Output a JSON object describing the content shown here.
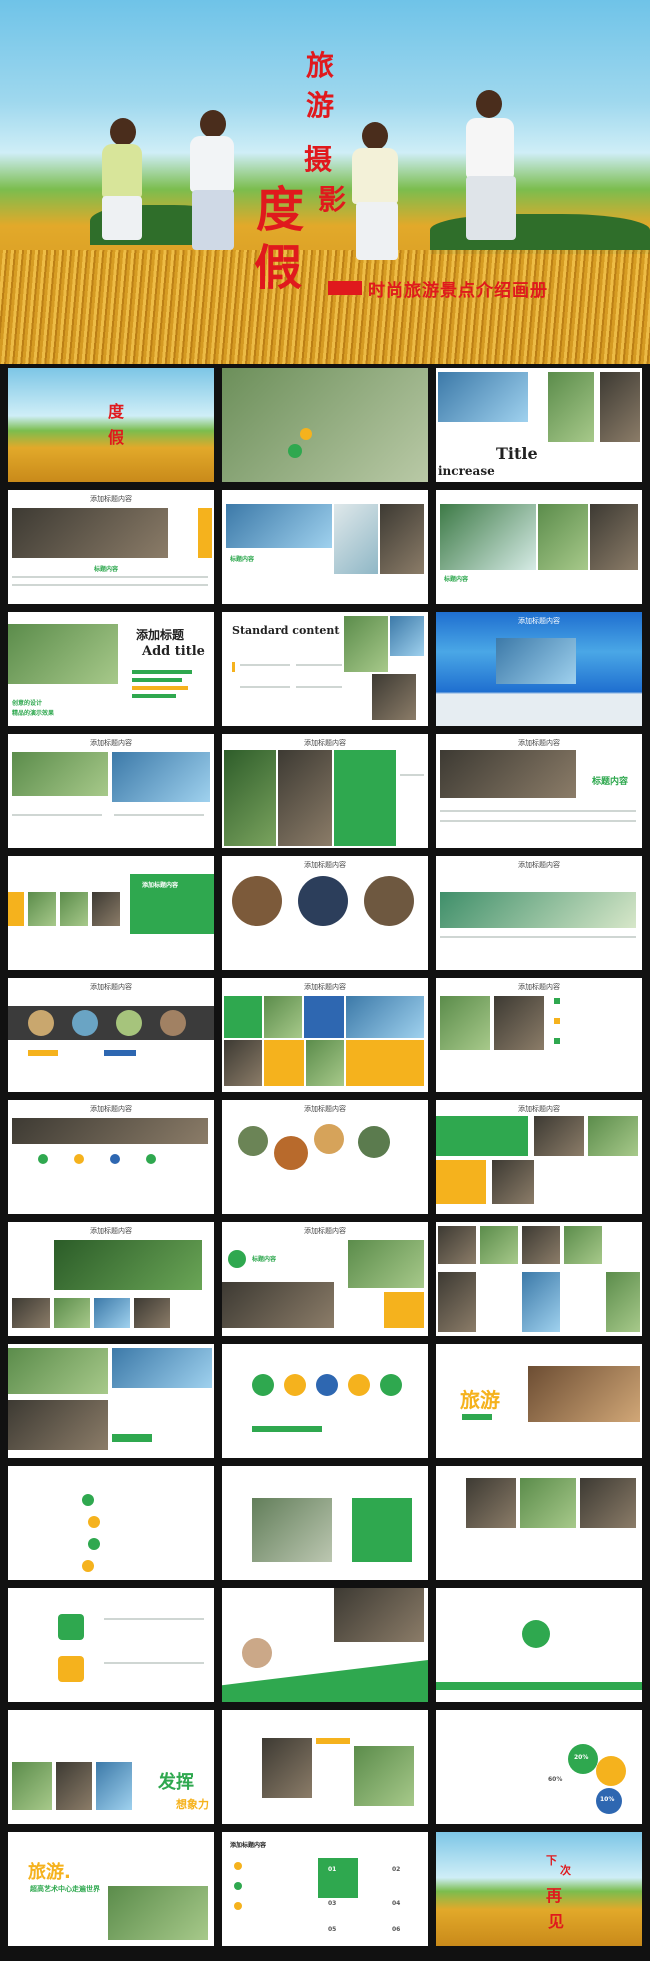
{
  "hero": {
    "title_chars": [
      "旅",
      "游",
      "摄",
      "影"
    ],
    "big_chars": [
      "度",
      "假"
    ],
    "subtitle": "时尚旅游景点介绍画册"
  },
  "slides": {
    "s03": {
      "title": "Title",
      "sub": "increase"
    },
    "s04": {
      "title": "添加标题内容",
      "caption": "标题内容"
    },
    "s05": {
      "caption": "标题内容"
    },
    "s06": {
      "caption": "标题内容"
    },
    "s07": {
      "title": "添加标题",
      "sub": "Add title",
      "line1": "创意的设计",
      "line2": "精品的演示效果"
    },
    "s08": {
      "title": "Standard content"
    },
    "s09": {
      "title": "添加标题内容"
    },
    "s10": {
      "title": "添加标题内容"
    },
    "s11": {
      "title": "添加标题内容"
    },
    "s12": {
      "title": "添加标题内容",
      "tag": "标题内容"
    },
    "s13": {
      "title": "添加标题内容",
      "tag": "添加标题内容"
    },
    "s14": {
      "title": "添加标题内容"
    },
    "s15": {
      "title": "添加标题内容"
    },
    "s16": {
      "title": "添加标题内容"
    },
    "s17": {
      "title": "添加标题内容"
    },
    "s18": {
      "title": "添加标题内容"
    },
    "s19": {
      "title": "添加标题内容"
    },
    "s20": {
      "title": "添加标题内容"
    },
    "s21": {
      "title": "添加标题内容"
    },
    "s22": {
      "title": "添加标题内容"
    },
    "s23": {
      "title": "添加标题内容",
      "tag": "标题内容"
    },
    "s26": {
      "title": "旅游"
    },
    "s37": {
      "title": "发挥",
      "sub": "想象力"
    },
    "s39": {
      "p1": "20%",
      "p2": "60%",
      "p3": "10%"
    },
    "s40": {
      "title": "旅游.",
      "sub": "超高艺术中心走遍世界"
    },
    "s41": {
      "title": "添加标题内容",
      "n1": "01",
      "n2": "02",
      "n3": "03",
      "n4": "04",
      "n5": "05",
      "n6": "06"
    },
    "s42": {
      "chars": [
        "下",
        "次",
        "再",
        "见"
      ]
    }
  },
  "colors": {
    "accent_green": "#2fa84f",
    "accent_yellow": "#f5b21d",
    "accent_blue": "#2e67b1",
    "red": "#e0191d"
  }
}
